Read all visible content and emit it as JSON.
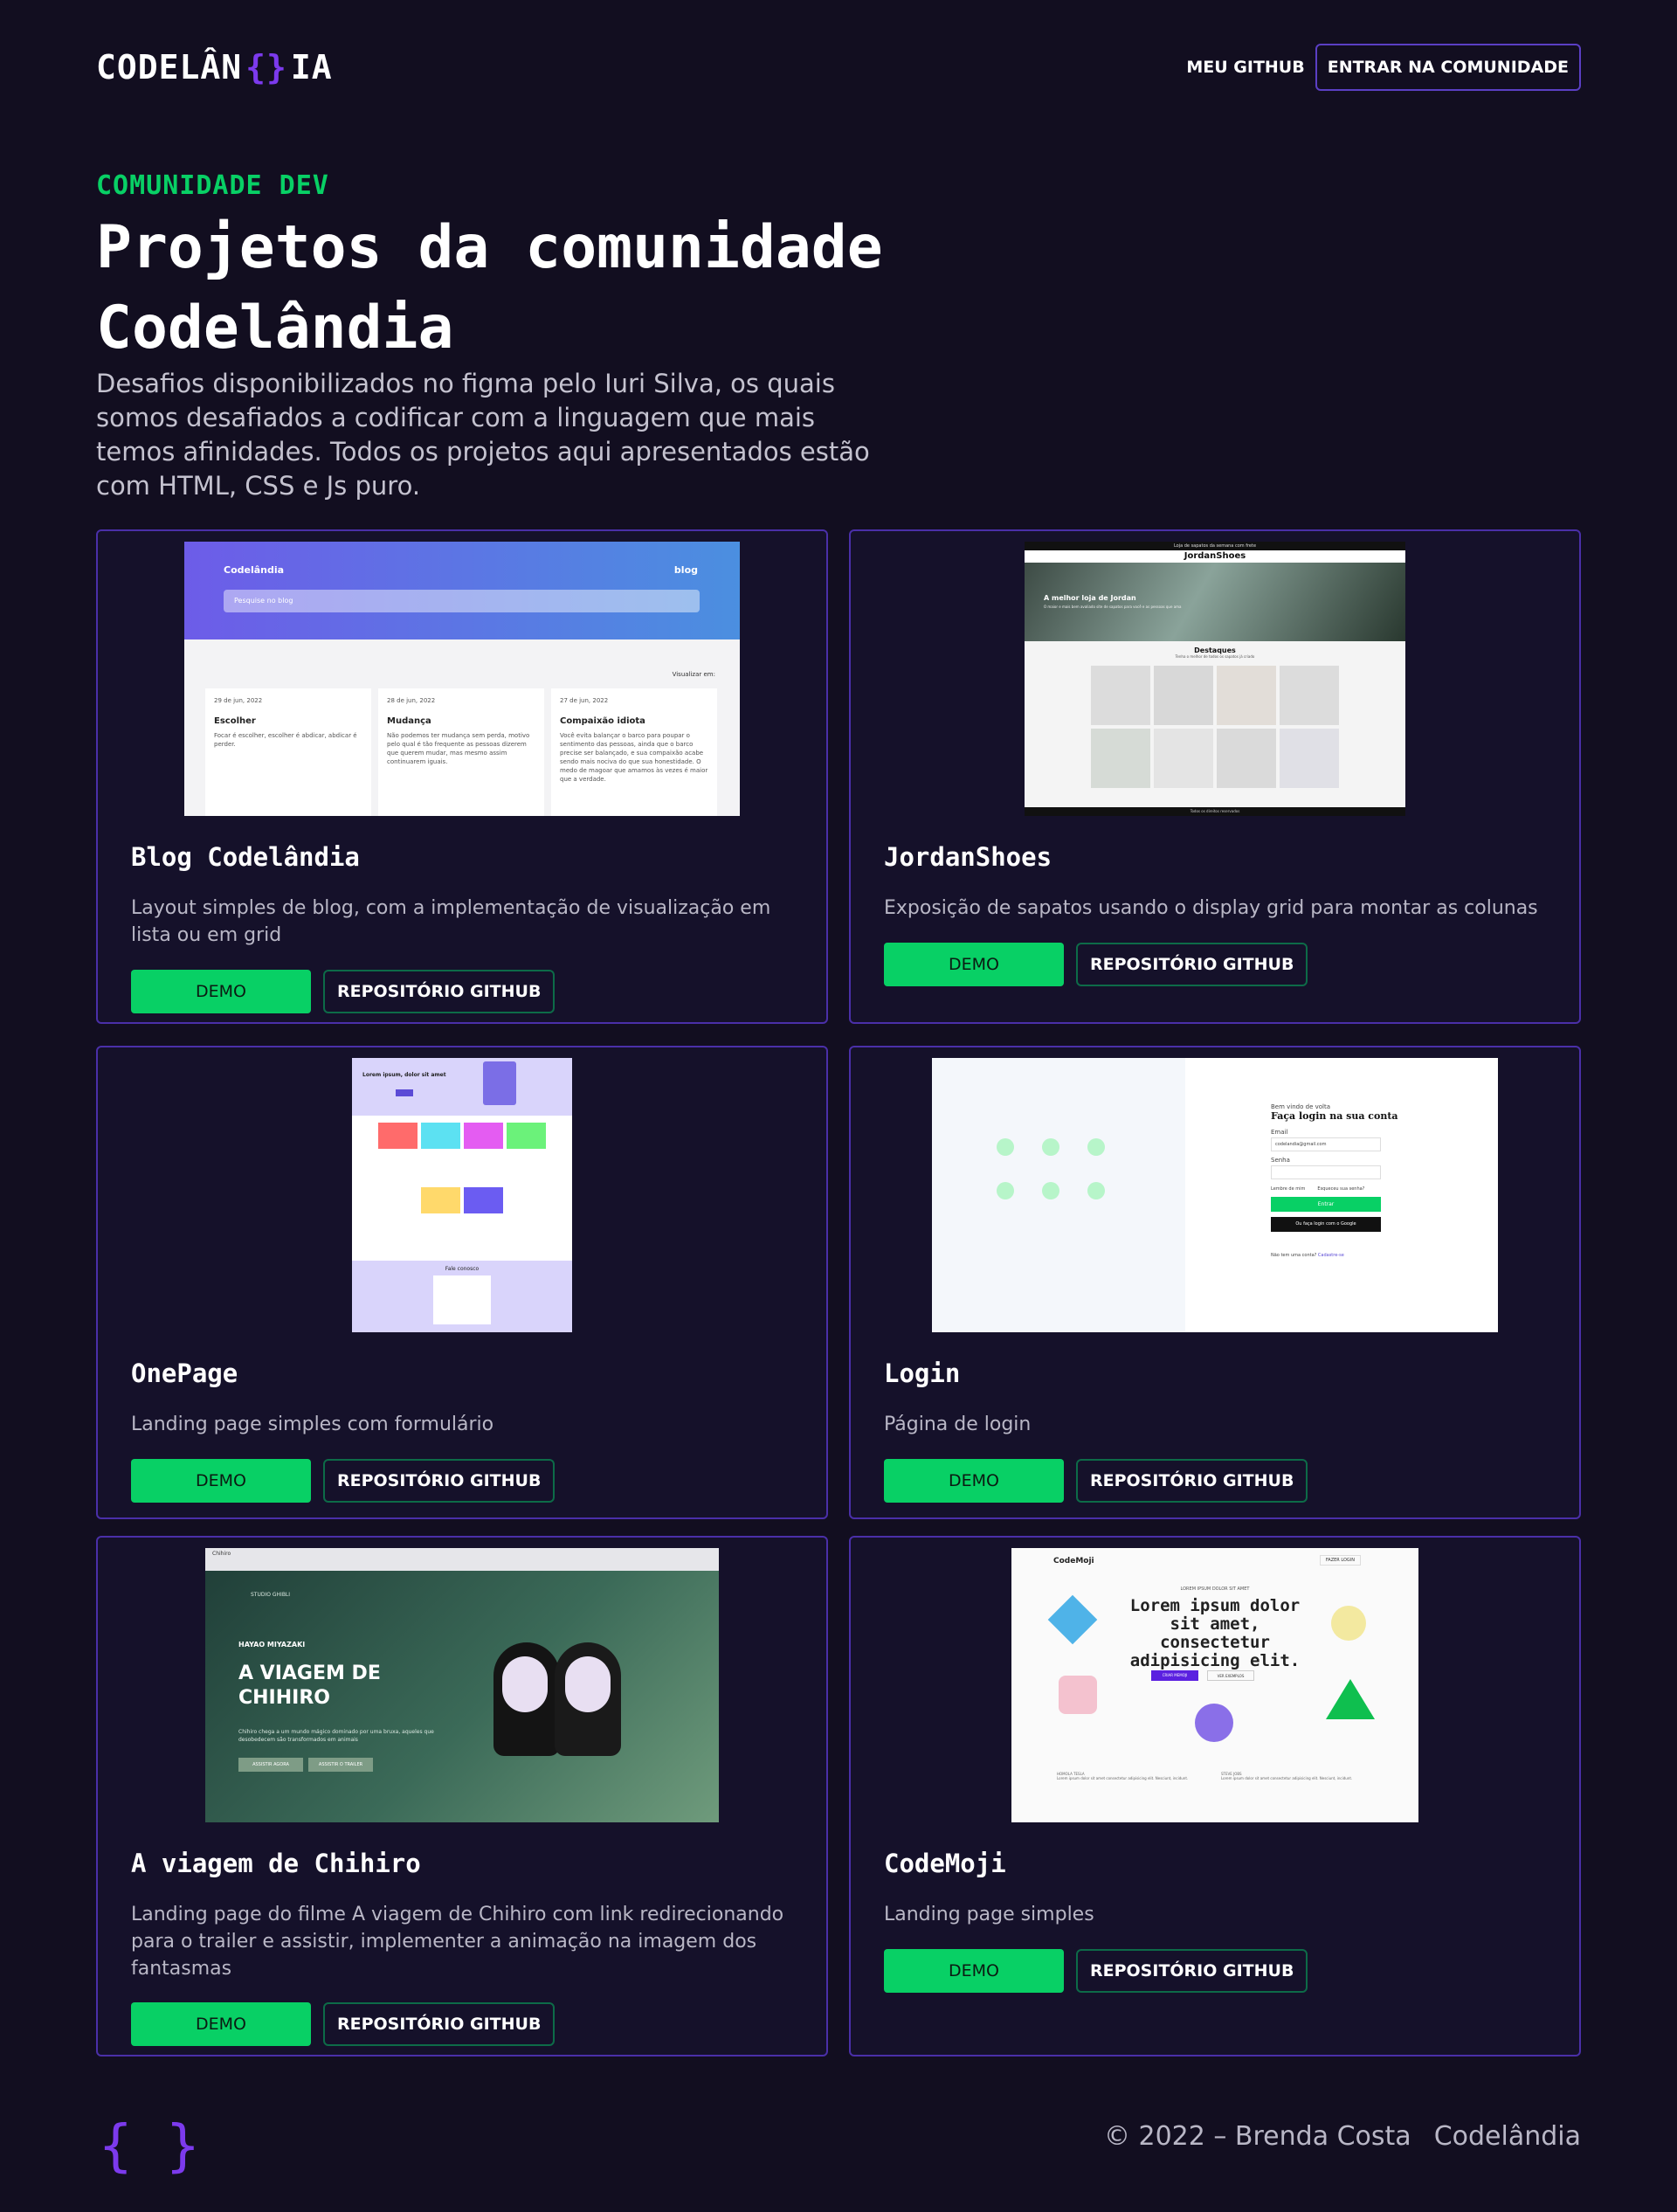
{
  "header": {
    "logo_left": "CODELÂN",
    "logo_brace": "{}",
    "logo_right": "IA",
    "nav_github": "MEU GITHUB",
    "nav_community": "ENTRAR NA COMUNIDADE"
  },
  "hero": {
    "eyebrow": "COMUNIDADE DEV",
    "title": "Projetos da comunidade Codelândia",
    "subtitle": "Desafios disponibilizados no figma pelo Iuri Silva, os quais somos desafiados a codificar com a linguagem que mais temos afinidades. Todos os projetos aqui apresentados estão com HTML, CSS e Js puro."
  },
  "projects": [
    {
      "title": "Blog Codelândia",
      "description": "Layout simples de blog, com a implementação de visualização em lista ou em grid",
      "demo": "DEMO",
      "repo": "REPOSITÓRIO GITHUB"
    },
    {
      "title": "JordanShoes",
      "description": "Exposição de sapatos usando o display grid para montar as colunas",
      "demo": "DEMO",
      "repo": "REPOSITÓRIO GITHUB"
    },
    {
      "title": "OnePage",
      "description": "Landing page simples com formulário",
      "demo": "DEMO",
      "repo": "REPOSITÓRIO GITHUB"
    },
    {
      "title": "Login",
      "description": "Página de login",
      "demo": "DEMO",
      "repo": "REPOSITÓRIO GITHUB"
    },
    {
      "title": "A viagem de Chihiro",
      "description": "Landing page do filme A viagem de Chihiro com link redirecionando para o trailer e assistir, implementer a animação na imagem dos fantasmas",
      "demo": "DEMO",
      "repo": "REPOSITÓRIO GITHUB"
    },
    {
      "title": "CodeMoji",
      "description": "Landing page simples",
      "demo": "DEMO",
      "repo": "REPOSITÓRIO GITHUB"
    }
  ],
  "thumbs": {
    "blog": {
      "brand": "Codelândia",
      "nav": "blog",
      "search": "Pesquise no blog",
      "view": "Visualizar em:",
      "posts": [
        {
          "date": "29 de jun, 2022",
          "title": "Escolher",
          "text": "Focar é escolher, escolher é abdicar, abdicar é perder."
        },
        {
          "date": "28 de jun, 2022",
          "title": "Mudança",
          "text": "Não podemos ter mudança sem perda, motivo pelo qual é tão frequente as pessoas dizerem que querem mudar, mas mesmo assim continuarem iguais."
        },
        {
          "date": "27 de jun, 2022",
          "title": "Compaixão idiota",
          "text": "Você evita balançar o barco para poupar o sentimento das pessoas, ainda que o barco precise ser balançado, e sua compaixão acabe sendo mais nociva do que sua honestidade. O medo de magoar que amamos às vezes é maior que a verdade."
        }
      ]
    },
    "jordan": {
      "top": "Loja de sapatos da semana com frete",
      "brand": "JordanShoes",
      "hero": "A melhor loja de Jordan",
      "hero_sub": "O maior e mais bem avaliado site de sapatos para você e as pessoas que ama",
      "section": "Destaques",
      "section_sub": "Tenha o melhor de todos os sapatos já criado",
      "footer": "Todos os direitos reservados"
    },
    "onepage": {
      "hero": "Lorem ipsum, dolor sit amet",
      "form": "Fale conosco"
    },
    "login": {
      "welcome": "Bem vindo de volta",
      "heading": "Faça login na sua conta",
      "email": "Email",
      "email_value": "codelandia@gmail.com",
      "password": "Senha",
      "remember": "Lembre de mim",
      "forgot": "Esqueceu sua senha?",
      "enter": "Entrar",
      "google": "Ou faça login com o Google",
      "no_account": "Não tem uma conta?",
      "signup": "Cadastre-se"
    },
    "chihiro": {
      "studio": "STUDIO GHIBLI",
      "director": "HAYAO MIYAZAKI",
      "heading": "A VIAGEM DE CHIHIRO",
      "text": "Chihiro chega a um mundo mágico dominado por uma bruxa, aqueles que desobedecem são transformados em animais",
      "btn1": "ASSISTIR AGORA",
      "btn2": "ASSISTIR O TRAILER",
      "tab": "Chihiro"
    },
    "codemoji": {
      "brand": "CodeMoji",
      "nav_btn": "FAZER LOGIN",
      "eyebrow": "LOREM IPSUM DOLOR SIT AMET",
      "heading": "Lorem ipsum dolor sit amet, consectetur adipisicing elit.",
      "btn1": "CRIAR MEMOJI",
      "btn2": "VER EXEMPLOS",
      "name1": "HOMOLA TESLA",
      "name2": "STEVE JOBS",
      "quote": "Lorem ipsum dolor sit amet consectetur adipisicing elit. Nesciunt, incidunt."
    }
  },
  "footer": {
    "logo": "{ }",
    "copyright": "© 2022 – Brenda Costa",
    "brand": "Codelândia"
  },
  "colors": {
    "background": "#120e20",
    "accent_green": "#08d065",
    "accent_purple": "#5b3fc4"
  }
}
